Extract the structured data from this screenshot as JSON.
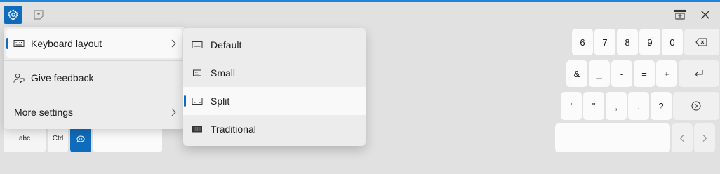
{
  "colors": {
    "accent": "#0f6cbd",
    "background": "#e1e1e1"
  },
  "top_bar": {
    "settings_icon": "gear-icon",
    "sticker_icon": "sticker-icon",
    "dock_icon": "dock-icon",
    "close_icon": "close-icon"
  },
  "menu": {
    "items": [
      {
        "label": "Keyboard layout",
        "icon": "keyboard-icon",
        "has_submenu": true,
        "selected": true
      },
      {
        "label": "Give feedback",
        "icon": "feedback-icon",
        "has_submenu": false
      },
      {
        "label": "More settings",
        "has_submenu": true
      }
    ]
  },
  "submenu": {
    "items": [
      {
        "label": "Default",
        "icon": "keyboard-default-icon"
      },
      {
        "label": "Small",
        "icon": "keyboard-small-icon"
      },
      {
        "label": "Split",
        "icon": "keyboard-split-icon",
        "selected": true
      },
      {
        "label": "Traditional",
        "icon": "keyboard-traditional-icon"
      }
    ]
  },
  "keyboard_left": {
    "keys": [
      "abc",
      "Ctrl"
    ],
    "emoji_icon": "emoji-icon"
  },
  "keyboard_right": {
    "row1": [
      "6",
      "7",
      "8",
      "9",
      "0"
    ],
    "row2": [
      "&",
      "_",
      "-",
      "=",
      "+"
    ],
    "row3": [
      "'",
      "\"",
      ",",
      ".",
      "?"
    ],
    "backspace_icon": "backspace-icon",
    "enter_icon": "enter-icon",
    "next_icon": "next-icon",
    "left_icon": "arrow-left-icon",
    "right_icon": "arrow-right-icon"
  }
}
